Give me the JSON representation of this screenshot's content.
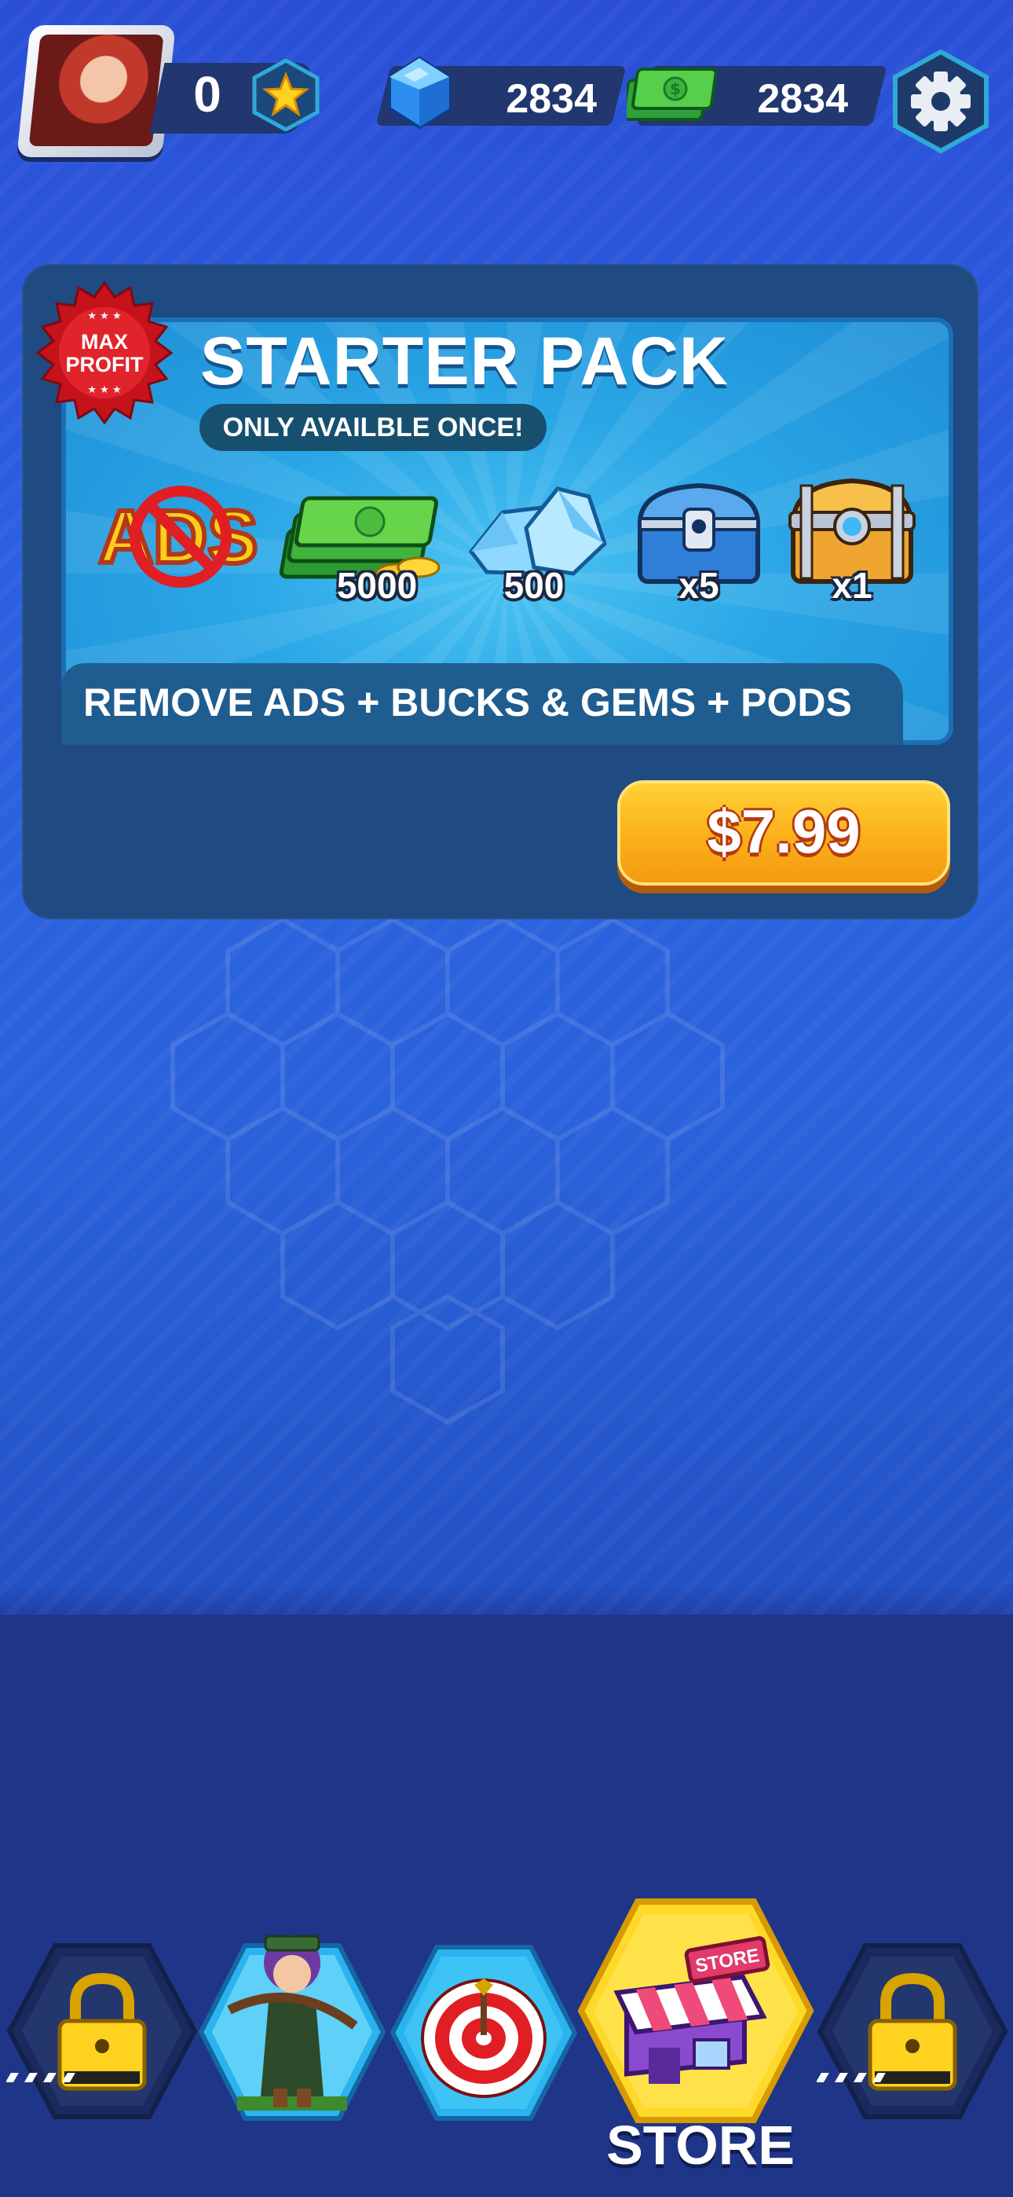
{
  "hud": {
    "stars": "0",
    "gems": "2834",
    "cash": "2834",
    "icons": [
      "avatar-portrait",
      "star-icon",
      "gem-icon",
      "cash-icon",
      "gear-icon"
    ]
  },
  "offer": {
    "badge": {
      "line1": "MAX",
      "line2": "PROFIT"
    },
    "title": "STARTER PACK",
    "subtitle": "ONLY AVAILBLE ONCE!",
    "items": [
      {
        "name": "no-ads",
        "art_text": "ADS",
        "label": ""
      },
      {
        "name": "cash",
        "label": "5000"
      },
      {
        "name": "gems",
        "label": "500"
      },
      {
        "name": "blue-chest",
        "label": "x5"
      },
      {
        "name": "gold-chest",
        "label": "x1"
      }
    ],
    "banner": "REMOVE ADS + BUCKS & GEMS + PODS",
    "price": "$7.99"
  },
  "nav": {
    "store_label": "STORE",
    "store_sign": "STORE",
    "tabs": [
      "locked-tab-1",
      "hero-tab",
      "target-tab",
      "store-tab",
      "locked-tab-2"
    ]
  },
  "colors": {
    "background": "#2a57d8",
    "card": "#1f4a82",
    "panel": "#2aa6e6",
    "price_button": "#fbb01a",
    "store_hex": "#ffd92a"
  }
}
